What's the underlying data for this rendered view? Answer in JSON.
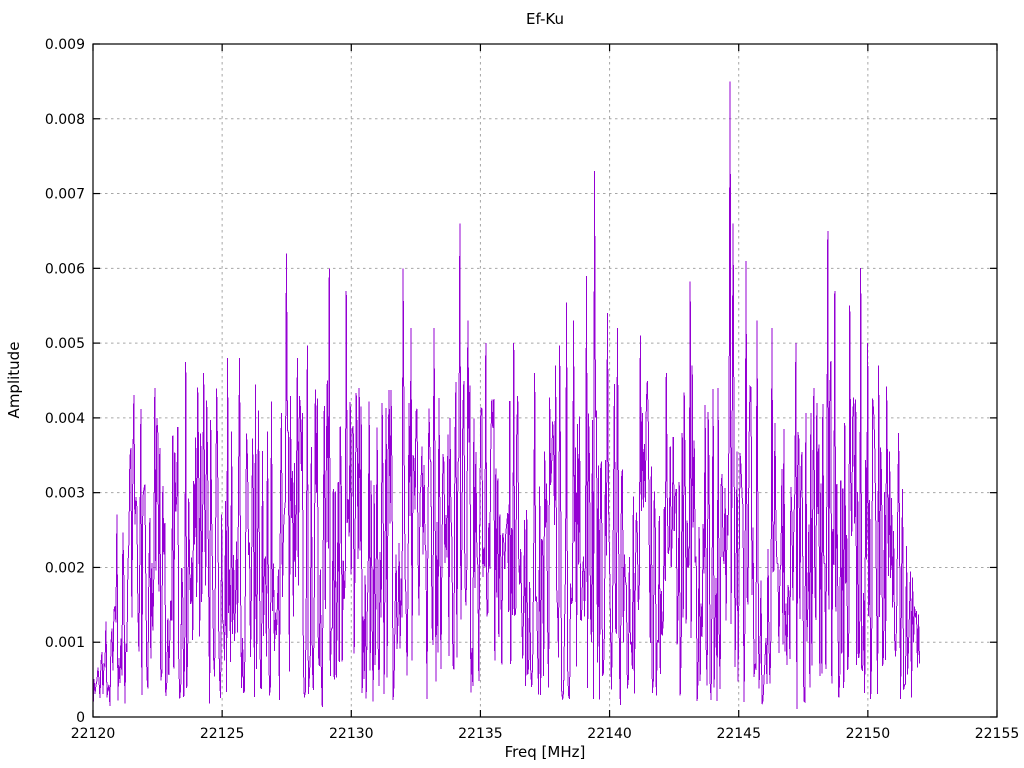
{
  "page": {
    "background_color": "#ffffff"
  },
  "chart_data": {
    "type": "line",
    "title": "Ef-Ku",
    "xlabel": "Freq [MHz]",
    "ylabel": "Amplitude",
    "xlim": [
      22120,
      22155
    ],
    "ylim": [
      0,
      0.009
    ],
    "x_ticks": [
      22120,
      22125,
      22130,
      22135,
      22140,
      22145,
      22150,
      22155
    ],
    "x_tick_labels": [
      "22120",
      "22125",
      "22130",
      "22135",
      "22140",
      "22145",
      "22150",
      "22155"
    ],
    "y_ticks": [
      0,
      0.001,
      0.002,
      0.003,
      0.004,
      0.005,
      0.006,
      0.007,
      0.008,
      0.009
    ],
    "y_tick_labels": [
      "0",
      "0.001",
      "0.002",
      "0.003",
      "0.004",
      "0.005",
      "0.006",
      "0.007",
      "0.008",
      "0.009"
    ],
    "grid": true,
    "legend": "none",
    "line_color": "#9400d3",
    "grid_color": "#a6a6a6",
    "axis_color": "#000000",
    "series": [
      {
        "name": "Ef-Ku",
        "style": "noisy-spectrum-line",
        "x_start": 22120,
        "x_end": 22152,
        "n_points": 830,
        "seed": 1337,
        "noise": {
          "min": 0.0002,
          "span": 0.0043,
          "shape": 1.1,
          "spike_prob": 0.02,
          "spike_base": 0.0008,
          "spike_extra": 0.0016,
          "dip_prob": 0.035,
          "dip_base": 0.0001,
          "dip_span": 0.0007
        },
        "edge_ramp": {
          "left_until": 22121.6,
          "left_min": 0.12,
          "right_from": 22150.8,
          "right_min": 0.3
        },
        "peaks": [
          [
            22122.4,
            0.0044
          ],
          [
            22123.6,
            0.00475
          ],
          [
            22124.3,
            0.0046
          ],
          [
            22125.2,
            0.0048
          ],
          [
            22125.66,
            0.0048
          ],
          [
            22126.4,
            0.0041
          ],
          [
            22127.48,
            0.0062
          ],
          [
            22127.9,
            0.0048
          ],
          [
            22129.15,
            0.006
          ],
          [
            22129.8,
            0.0057
          ],
          [
            22130.3,
            0.0044
          ],
          [
            22131.2,
            0.0042
          ],
          [
            22132.0,
            0.006
          ],
          [
            22132.3,
            0.0052
          ],
          [
            22133.2,
            0.0052
          ],
          [
            22134.2,
            0.0066
          ],
          [
            22134.5,
            0.0053
          ],
          [
            22135.2,
            0.005
          ],
          [
            22136.3,
            0.005
          ],
          [
            22137.1,
            0.0046
          ],
          [
            22137.9,
            0.0047
          ],
          [
            22138.6,
            0.0053
          ],
          [
            22139.1,
            0.0059
          ],
          [
            22139.4,
            0.0073
          ],
          [
            22139.9,
            0.0054
          ],
          [
            22140.3,
            0.0052
          ],
          [
            22141.2,
            0.0051
          ],
          [
            22142.2,
            0.0046
          ],
          [
            22143.2,
            0.0047
          ],
          [
            22144.2,
            0.0044
          ],
          [
            22144.65,
            0.0085
          ],
          [
            22144.8,
            0.0066
          ],
          [
            22145.3,
            0.0061
          ],
          [
            22145.7,
            0.0053
          ],
          [
            22146.3,
            0.0052
          ],
          [
            22147.2,
            0.005
          ],
          [
            22147.9,
            0.0044
          ],
          [
            22148.45,
            0.0065
          ],
          [
            22148.7,
            0.0057
          ],
          [
            22149.3,
            0.0055
          ],
          [
            22150.0,
            0.005
          ],
          [
            22150.4,
            0.0047
          ],
          [
            22151.2,
            0.0038
          ]
        ]
      }
    ],
    "max_peak": {
      "freq": 22144.65,
      "amplitude": 0.0085
    },
    "noise_floor_mean": 0.0022
  }
}
